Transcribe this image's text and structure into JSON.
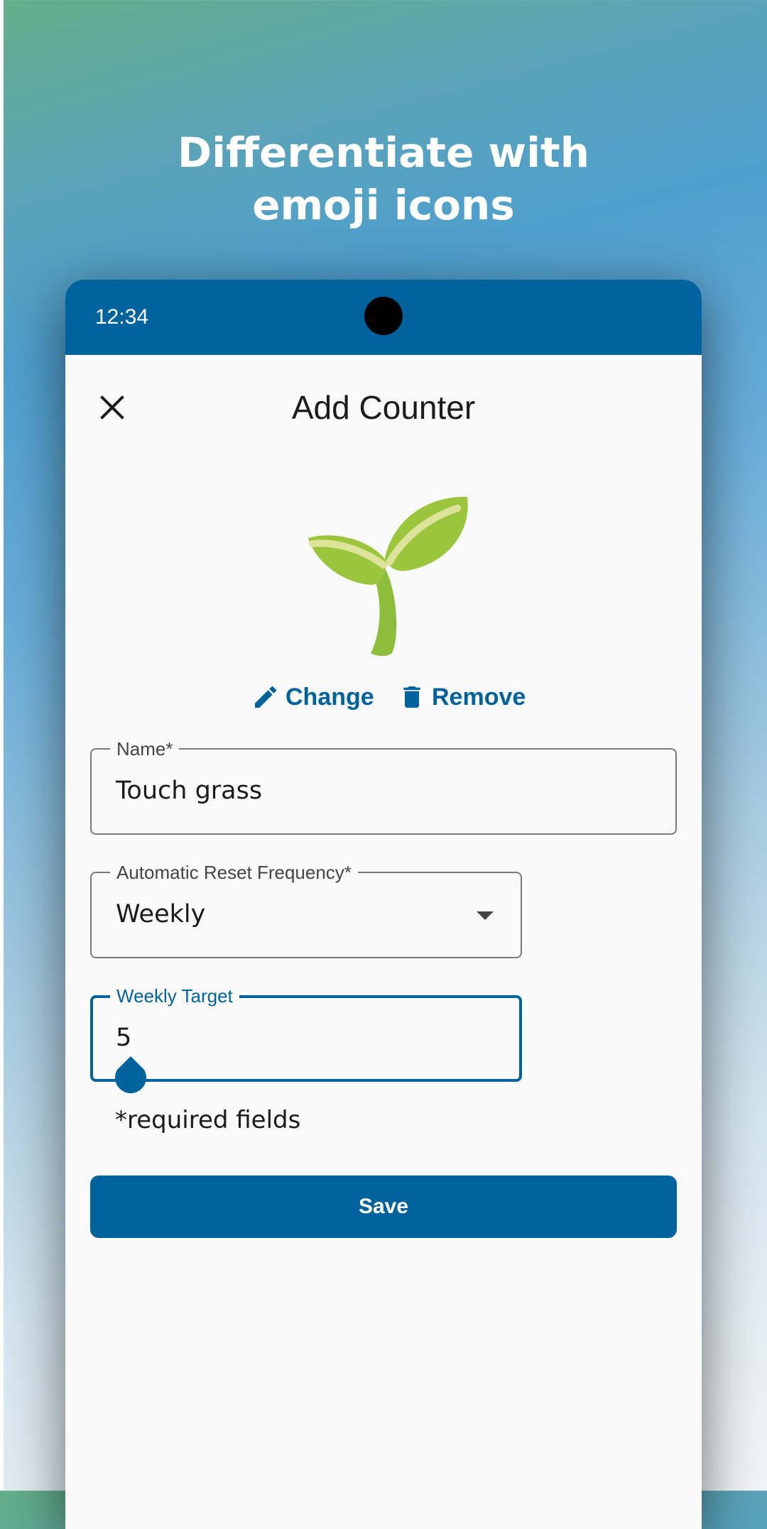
{
  "promo": {
    "title_line1": "Differentiate with",
    "title_line2": "emoji icons"
  },
  "status_bar": {
    "time": "12:34"
  },
  "header": {
    "title": "Add Counter",
    "close_icon": "close-icon"
  },
  "icon": {
    "emoji": "seedling"
  },
  "icon_actions": {
    "change_label": "Change",
    "remove_label": "Remove"
  },
  "form": {
    "name": {
      "label": "Name*",
      "value": "Touch grass"
    },
    "reset_frequency": {
      "label": "Automatic Reset Frequency*",
      "value": "Weekly"
    },
    "weekly_target": {
      "label": "Weekly Target",
      "value": "5"
    },
    "required_note": "*required fields",
    "save_label": "Save"
  },
  "colors": {
    "primary": "#00639e",
    "background": "#f9f9f9",
    "text": "#1b1b1b",
    "outline": "#7a7a7a"
  }
}
